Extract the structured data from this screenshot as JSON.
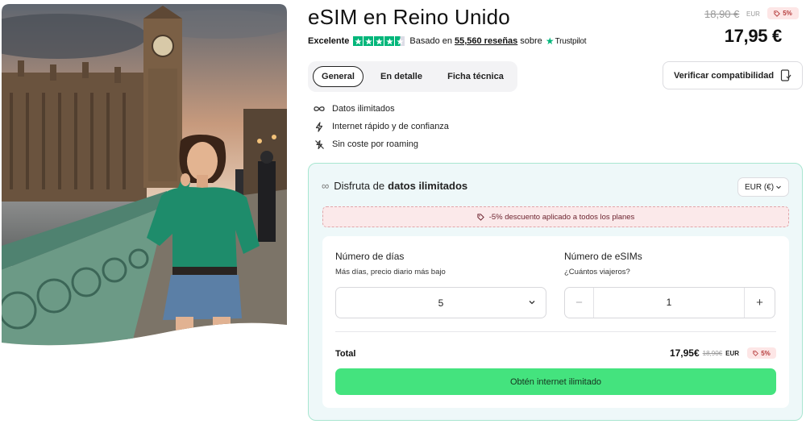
{
  "product": {
    "title": "eSIM en Reino Unido",
    "rating": {
      "label": "Excelente",
      "based_on": "Basado en",
      "reviews_count": "55,560 reseñas",
      "on_text": "sobre",
      "provider": "Trustpilot",
      "stars": 4.5
    },
    "old_price": "18,90 €",
    "old_price_currency": "EUR",
    "discount_badge": "5%",
    "price": "17,95 €"
  },
  "tabs": [
    {
      "label": "General",
      "active": true
    },
    {
      "label": "En detalle",
      "active": false
    },
    {
      "label": "Ficha técnica",
      "active": false
    }
  ],
  "verify_button": {
    "label": "Verificar compatibilidad"
  },
  "features": [
    {
      "icon": "infinity-icon",
      "text": "Datos ilimitados"
    },
    {
      "icon": "lightning-icon",
      "text": "Internet rápido y de confianza"
    },
    {
      "icon": "no-roaming-icon",
      "text": "Sin coste por roaming"
    }
  ],
  "plan": {
    "heading_prefix": "Disfruta de",
    "heading_bold": "datos ilimitados",
    "currency_select": "EUR (€)",
    "promo_text": "-5% descuento aplicado a todos los planes",
    "days": {
      "label": "Número de días",
      "sublabel": "Más días, precio diario más bajo",
      "value": "5"
    },
    "esims": {
      "label": "Número de eSIMs",
      "sublabel": "¿Cuántos viajeros?",
      "value": "1",
      "minus": "−",
      "plus": "+"
    },
    "total": {
      "label": "Total",
      "price": "17,95€",
      "old_price": "18,90€",
      "currency": "EUR",
      "badge": "5%"
    },
    "cta": "Obtén internet ilimitado"
  },
  "colors": {
    "accent_green": "#44e37e",
    "trustpilot_green": "#00b67a",
    "card_border": "#a8e6d0",
    "card_bg": "#eef8f9",
    "discount_text": "#b53b3b"
  }
}
